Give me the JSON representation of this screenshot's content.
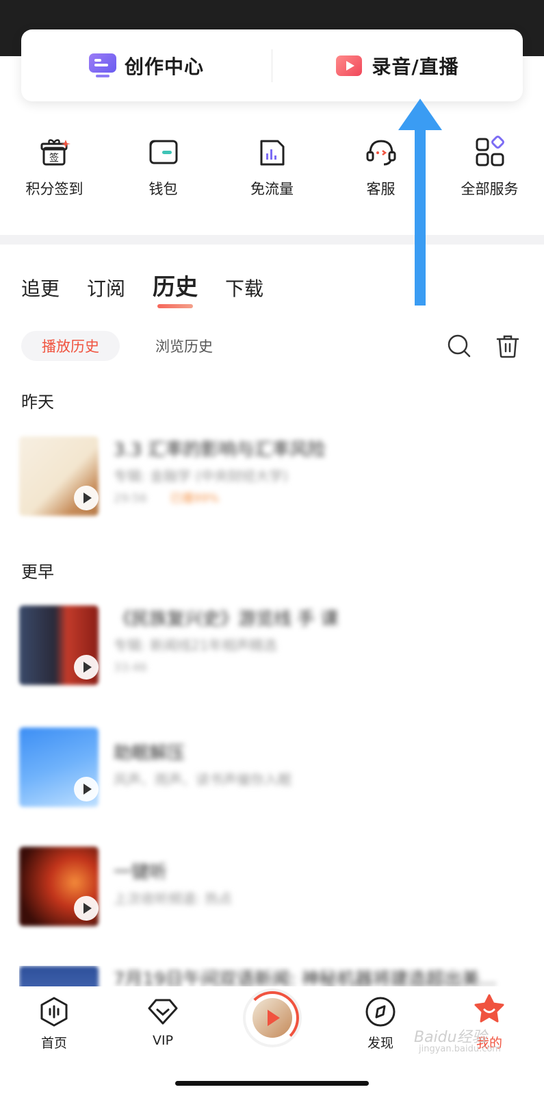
{
  "creator_card": {
    "left_label": "创作中心",
    "right_label": "录音/直播"
  },
  "services": [
    {
      "label": "积分签到",
      "icon": "gift-sign-icon",
      "badge": "签"
    },
    {
      "label": "钱包",
      "icon": "wallet-icon"
    },
    {
      "label": "免流量",
      "icon": "data-free-icon"
    },
    {
      "label": "客服",
      "icon": "customer-service-icon"
    },
    {
      "label": "全部服务",
      "icon": "all-services-icon"
    }
  ],
  "tabs": [
    {
      "label": "追更",
      "active": false
    },
    {
      "label": "订阅",
      "active": false
    },
    {
      "label": "历史",
      "active": true
    },
    {
      "label": "下载",
      "active": false
    }
  ],
  "subtabs": [
    {
      "label": "播放历史",
      "active": true
    },
    {
      "label": "浏览历史",
      "active": false
    }
  ],
  "sections": {
    "yesterday": "昨天",
    "earlier": "更早"
  },
  "history_items": [
    {
      "title": "3.3 汇率的影响与汇率风险",
      "subtitle": "专辑: 金融学 (中央财经大学)",
      "duration": "29:56",
      "progress": "已播99%"
    },
    {
      "title": "《民族复兴史》游览线 手 课",
      "subtitle": "专辑: 新闻线21年相声精选",
      "duration": "33:46",
      "progress": ""
    },
    {
      "title": "助眠解压",
      "subtitle": "风声、雨声、读书声催你入眠",
      "duration": "",
      "progress": ""
    },
    {
      "title": "一键听",
      "subtitle": "上次收听频道: 热点",
      "duration": "",
      "progress": ""
    },
    {
      "title": "7月19日午间双语新闻: 神秘机器将建造超出美...",
      "subtitle": "",
      "duration": "",
      "progress": ""
    }
  ],
  "bottom_nav": [
    {
      "label": "首页",
      "icon": "home-icon",
      "active": false
    },
    {
      "label": "VIP",
      "icon": "vip-icon",
      "active": false
    },
    {
      "label": "发现",
      "icon": "discover-icon",
      "active": false
    },
    {
      "label": "我的",
      "icon": "mine-icon",
      "active": true
    }
  ],
  "colors": {
    "accent": "#f0533f",
    "arrow": "#3a9cf3",
    "creator_icon": "#7c6cf4",
    "record_icon": "#f0475a"
  },
  "watermark": {
    "main": "Baidu经验",
    "sub": "jingyan.baidu.com"
  }
}
